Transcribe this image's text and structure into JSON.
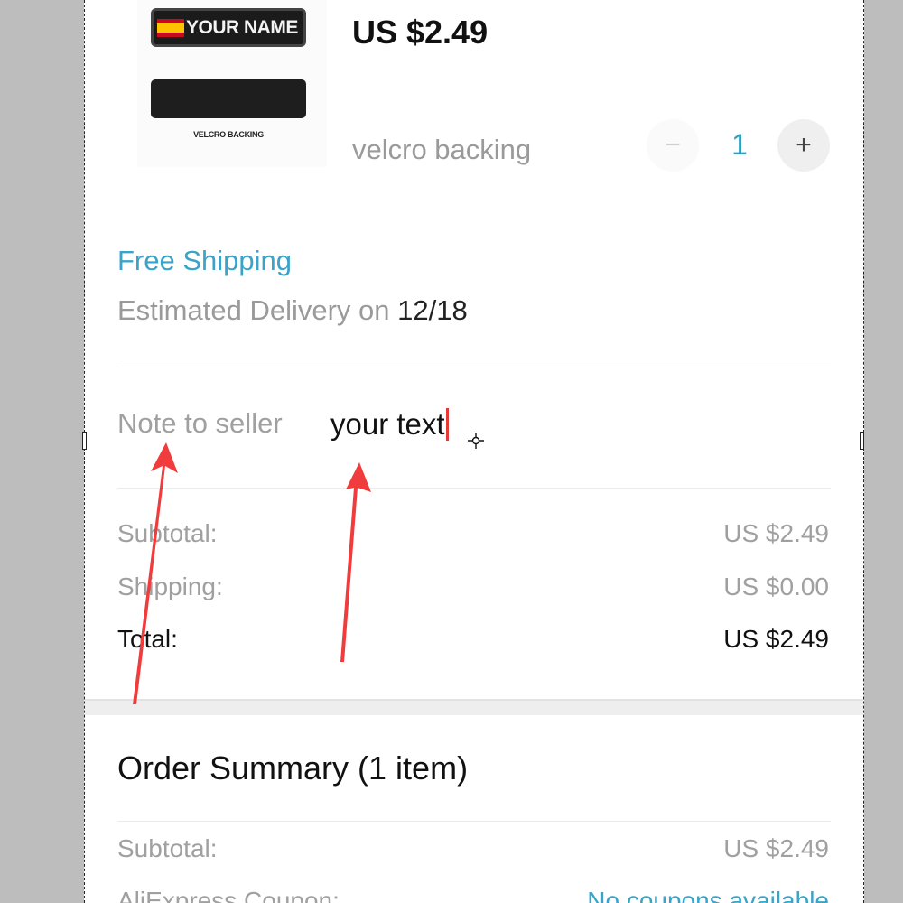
{
  "product": {
    "image": {
      "patch_text": "YOUR NAME",
      "caption": "VELCRO BACKING"
    },
    "price": "US $2.49",
    "sku": "velcro backing",
    "quantity": {
      "minus_symbol": "−",
      "value": "1",
      "plus_symbol": "+"
    }
  },
  "shipping": {
    "method": "Free Shipping",
    "delivery_prefix": "Estimated Delivery on ",
    "delivery_date": "12/18"
  },
  "note": {
    "label": "Note to seller",
    "value": "your text"
  },
  "totals": {
    "subtotal_label": "Subtotal:",
    "subtotal_value": "US $2.49",
    "shipping_label": "Shipping:",
    "shipping_value": "US $0.00",
    "total_label": "Total:",
    "total_value": "US $2.49"
  },
  "order_summary": {
    "title": "Order Summary (1 item)",
    "subtotal_label": "Subtotal:",
    "subtotal_value": "US $2.49",
    "coupon_label": "AliExpress Coupon:",
    "coupon_value": "No coupons available"
  },
  "colors": {
    "accent": "#3aa3c8",
    "annotation_arrow": "#f03c3c",
    "caret": "#e53935"
  },
  "icons": [
    "minus-icon",
    "plus-icon",
    "move-cursor-icon",
    "spain-flag-icon",
    "annotation-arrow"
  ]
}
